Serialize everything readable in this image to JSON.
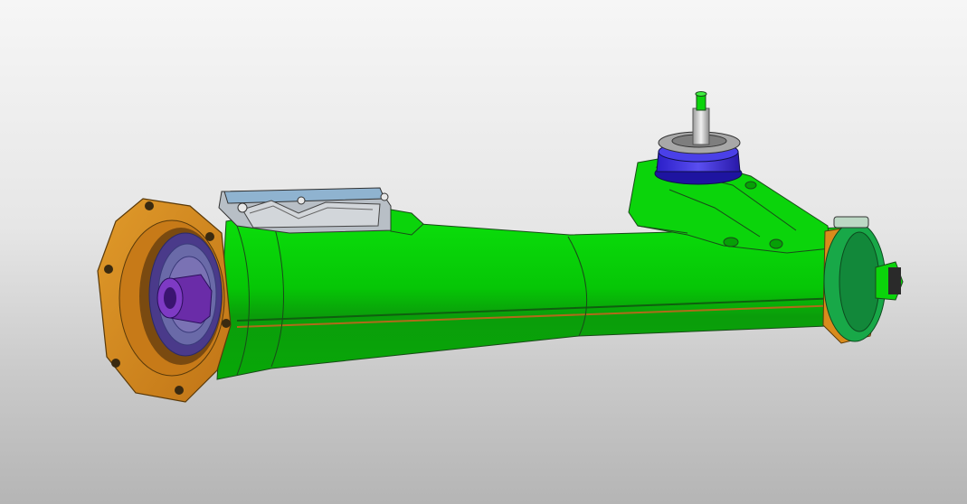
{
  "viewer": {
    "background_top": "#f6f6f6",
    "background_bottom": "#b5b5b5"
  },
  "model": {
    "parts": [
      {
        "name": "steering-rack-housing",
        "color": "#0acb0a"
      },
      {
        "name": "end-flange",
        "color": "#d98b1c"
      },
      {
        "name": "flange-bore",
        "color": "#c77a18"
      },
      {
        "name": "input-shaft-sleeve",
        "color": "#6a2ca8"
      },
      {
        "name": "pinion-bearing-cap",
        "color": "#3a2ad8"
      },
      {
        "name": "pinion-shaft",
        "color": "#bdbdbd"
      },
      {
        "name": "pinion-washer",
        "color": "#9a9a9a"
      },
      {
        "name": "control-unit-cover",
        "color": "#b8bfc6"
      },
      {
        "name": "control-unit-lid",
        "color": "#8fb3d0"
      },
      {
        "name": "end-boot-clamp",
        "color": "#16a045"
      },
      {
        "name": "outlet-coupler",
        "color": "#0acb0a"
      }
    ],
    "edge_color": "#1a4a1a"
  }
}
